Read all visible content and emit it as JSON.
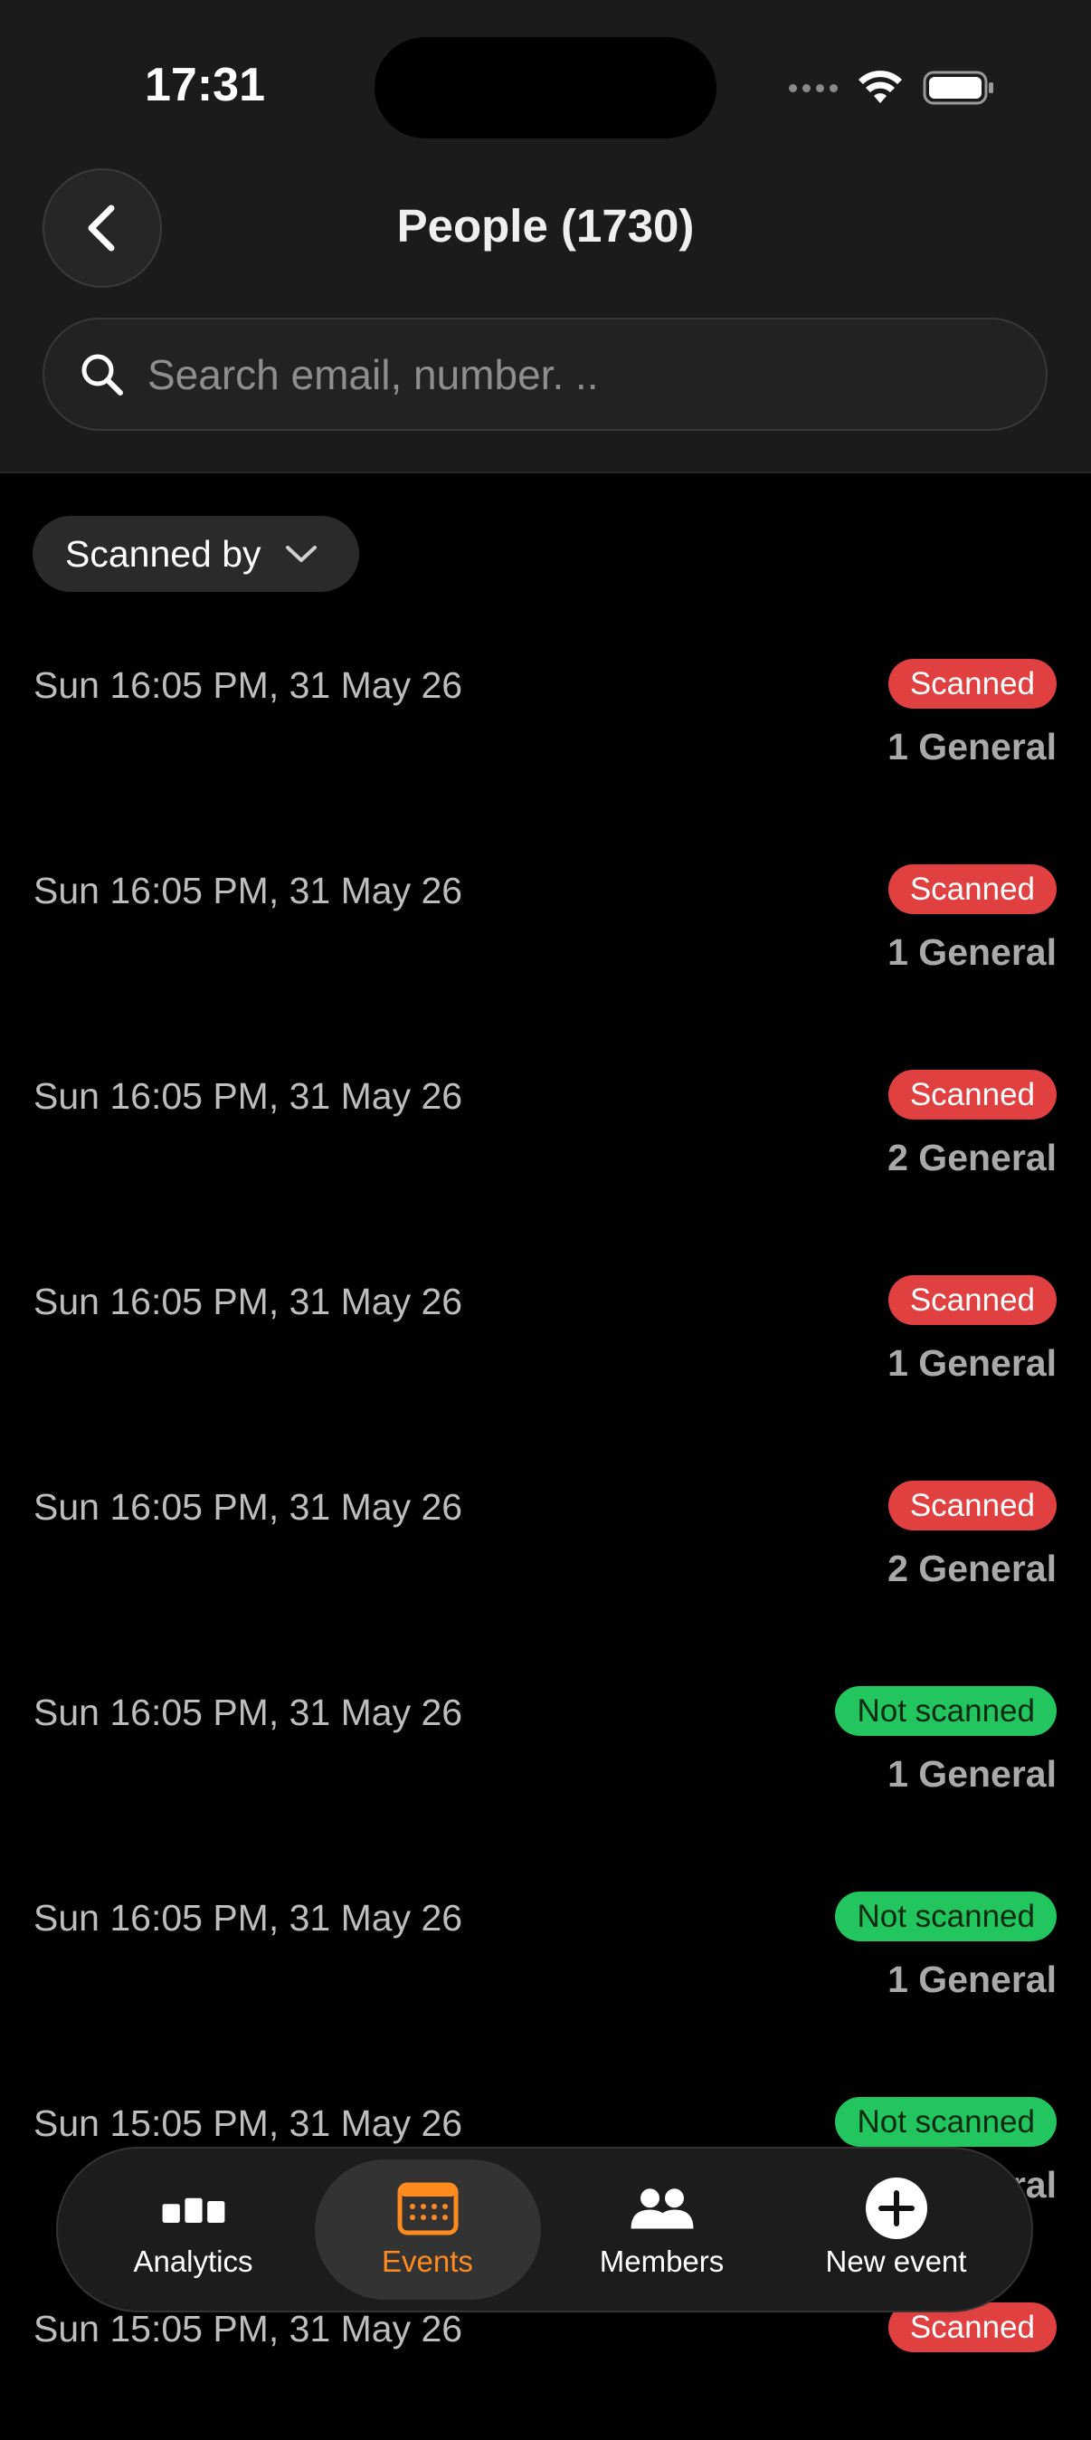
{
  "status_bar": {
    "time": "17:31"
  },
  "header": {
    "title": "People (1730)",
    "search_placeholder": "Search email, number. .."
  },
  "filter": {
    "label": "Scanned by"
  },
  "rows": [
    {
      "date": "Sun 16:05 PM, 31 May 26",
      "status": "Scanned",
      "tickets": "1 General"
    },
    {
      "date": "Sun 16:05 PM, 31 May 26",
      "status": "Scanned",
      "tickets": "1 General"
    },
    {
      "date": "Sun 16:05 PM, 31 May 26",
      "status": "Scanned",
      "tickets": "2 General"
    },
    {
      "date": "Sun 16:05 PM, 31 May 26",
      "status": "Scanned",
      "tickets": "1 General"
    },
    {
      "date": "Sun 16:05 PM, 31 May 26",
      "status": "Scanned",
      "tickets": "2 General"
    },
    {
      "date": "Sun 16:05 PM, 31 May 26",
      "status": "Not scanned",
      "tickets": "1 General"
    },
    {
      "date": "Sun 16:05 PM, 31 May 26",
      "status": "Not scanned",
      "tickets": "1 General"
    },
    {
      "date": "Sun 15:05 PM, 31 May 26",
      "status": "Not scanned",
      "tickets": "1 General"
    },
    {
      "date": "Sun 15:05 PM, 31 May 26",
      "status": "Scanned",
      "tickets": ""
    }
  ],
  "tabbar": {
    "analytics": "Analytics",
    "events": "Events",
    "members": "Members",
    "new_event": "New event"
  },
  "colors": {
    "accent": "#ff8a1e",
    "scanned": "#e04040",
    "not_scanned": "#22c55e"
  }
}
